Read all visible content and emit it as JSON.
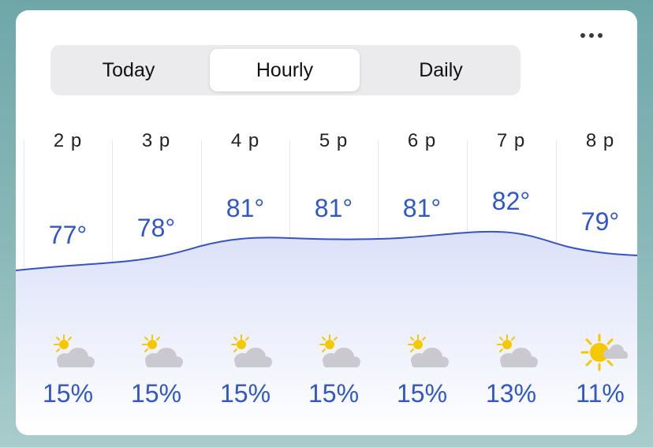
{
  "segmented_control": {
    "tabs": [
      {
        "label": "Today",
        "active": false
      },
      {
        "label": "Hourly",
        "active": true
      },
      {
        "label": "Daily",
        "active": false
      }
    ]
  },
  "more_button_icon": "ellipsis-icon",
  "hourly": [
    {
      "hour": "2 p",
      "temp": "77°",
      "condition_icon": "partly-cloudy-icon",
      "precip": "15%"
    },
    {
      "hour": "3 p",
      "temp": "78°",
      "condition_icon": "partly-cloudy-icon",
      "precip": "15%"
    },
    {
      "hour": "4 p",
      "temp": "81°",
      "condition_icon": "partly-cloudy-icon",
      "precip": "15%"
    },
    {
      "hour": "5 p",
      "temp": "81°",
      "condition_icon": "partly-cloudy-icon",
      "precip": "15%"
    },
    {
      "hour": "6 p",
      "temp": "81°",
      "condition_icon": "partly-cloudy-icon",
      "precip": "15%"
    },
    {
      "hour": "7 p",
      "temp": "82°",
      "condition_icon": "partly-cloudy-icon",
      "precip": "13%"
    },
    {
      "hour": "8 p",
      "temp": "79°",
      "condition_icon": "mostly-sunny-icon",
      "precip": "11%"
    }
  ],
  "colors": {
    "accent_blue": "#2f57c8",
    "curve_line": "#3553c4",
    "sun": "#f5c800",
    "cloud": "#c9c9cf"
  }
}
